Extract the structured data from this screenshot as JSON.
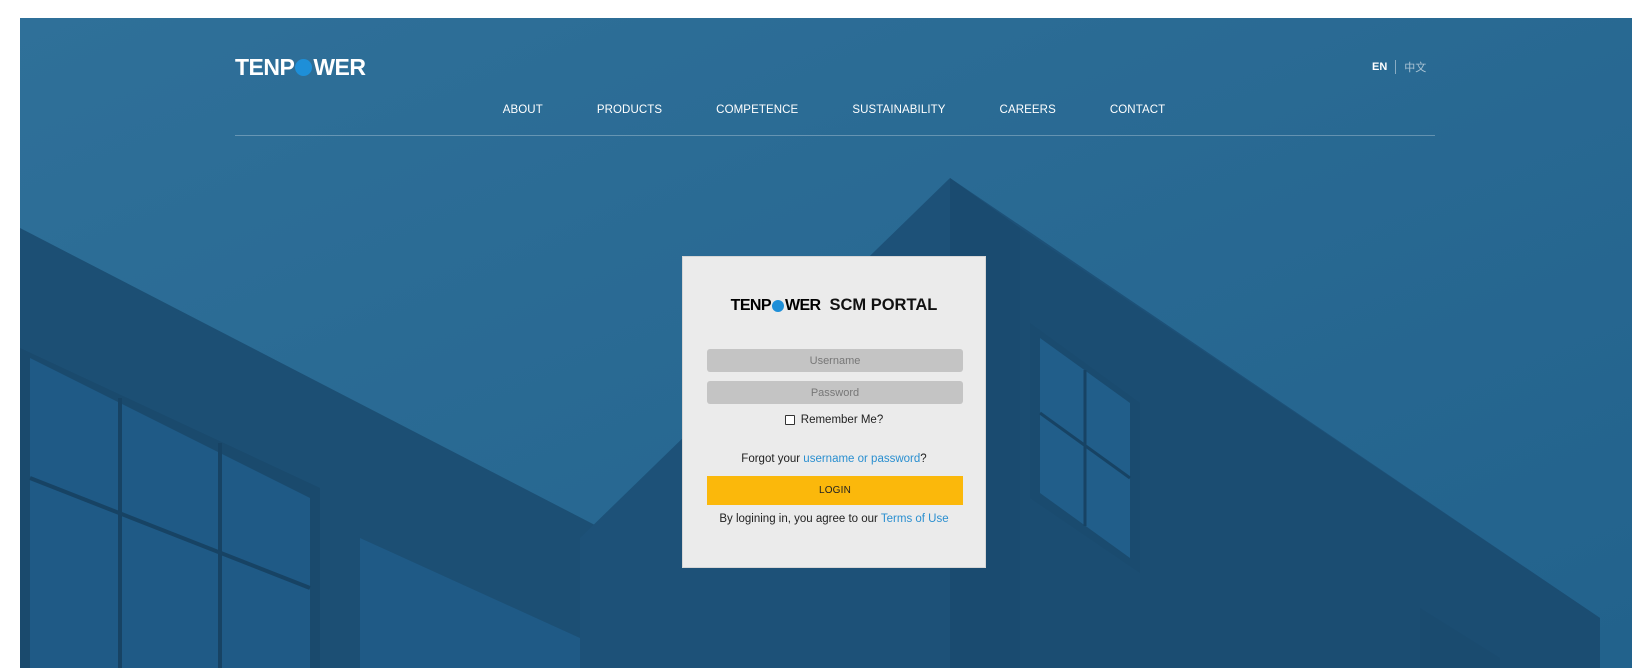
{
  "header": {
    "logo": {
      "left": "TENP",
      "right": "WER"
    },
    "lang": {
      "en": "EN",
      "zh": "中文"
    },
    "nav": [
      "ABOUT",
      "PRODUCTS",
      "COMPETENCE",
      "SUSTAINABILITY",
      "CAREERS",
      "CONTACT"
    ]
  },
  "login": {
    "brand": {
      "left": "TENP",
      "right": "WER"
    },
    "portal_title": "SCM PORTAL",
    "username_placeholder": "Username",
    "password_placeholder": "Password",
    "remember_label": "Remember Me?",
    "forgot_prefix": "Forgot your ",
    "forgot_link": "username or password",
    "forgot_suffix": "?",
    "login_button": "LOGIN",
    "terms_prefix": "By logining in, you agree to our ",
    "terms_link": "Terms of Use"
  },
  "colors": {
    "background": "#1f5d85",
    "accent_blue": "#1e8fd8",
    "login_button": "#fbb80b",
    "link": "#2a8fd0"
  }
}
